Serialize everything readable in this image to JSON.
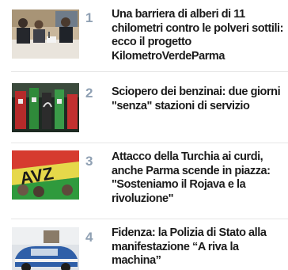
{
  "articles": [
    {
      "rank": "1",
      "title": "Una barriera di alberi di 11 chilometri contro le polveri sottili: ecco il progetto KilometroVerdeParma",
      "thumbnail": "press-conference-photo"
    },
    {
      "rank": "2",
      "title": "Sciopero dei benzinai: due giorni \"senza\" stazioni di servizio",
      "thumbnail": "fuel-pump-photo"
    },
    {
      "rank": "3",
      "title": "Attacco della Turchia ai curdi, anche Parma scende in piazza: \"Sosteniamo il Rojava e la rivoluzione\"",
      "thumbnail": "protest-flag-photo"
    },
    {
      "rank": "4",
      "title": "Fidenza: la Polizia di Stato alla manifestazione “A riva la machina”",
      "thumbnail": "police-car-photo"
    }
  ]
}
